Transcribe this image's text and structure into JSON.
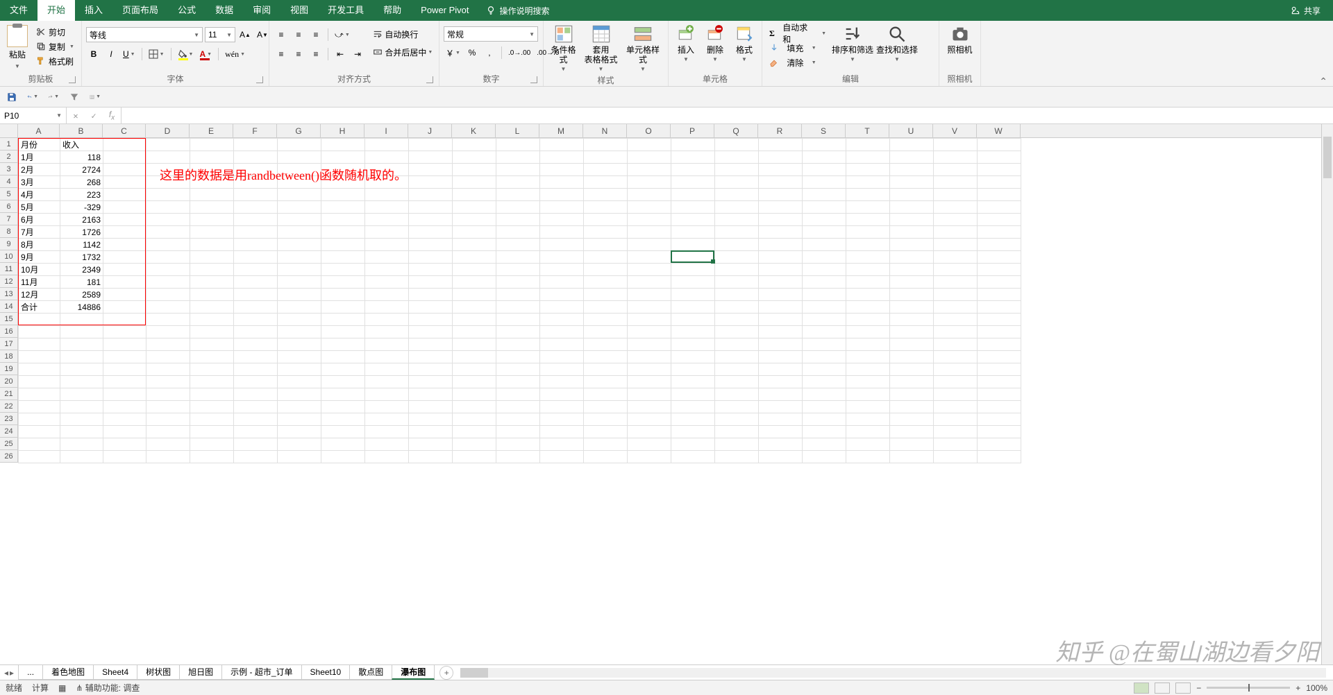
{
  "tabs": {
    "file": "文件",
    "home": "开始",
    "insert": "插入",
    "layout": "页面布局",
    "formulas": "公式",
    "data": "数据",
    "review": "审阅",
    "view": "视图",
    "dev": "开发工具",
    "help": "帮助",
    "powerpivot": "Power Pivot"
  },
  "tellme": "操作说明搜索",
  "share": "共享",
  "ribbon": {
    "clipboard": {
      "paste": "粘贴",
      "cut": "剪切",
      "copy": "复制",
      "painter": "格式刷",
      "label": "剪贴板"
    },
    "font": {
      "name": "等线",
      "size": "11",
      "label": "字体",
      "bold": "B",
      "italic": "I",
      "underline": "U"
    },
    "align": {
      "wrap": "自动换行",
      "merge": "合并后居中",
      "label": "对齐方式"
    },
    "number": {
      "format": "常规",
      "label": "数字",
      "percent": "%",
      "comma": ","
    },
    "styles": {
      "cond": "条件格式",
      "table": "套用\n表格格式",
      "cell": "单元格样式",
      "label": "样式"
    },
    "cells": {
      "insert": "插入",
      "delete": "删除",
      "format": "格式",
      "label": "单元格"
    },
    "editing": {
      "sum": "自动求和",
      "fill": "填充",
      "clear": "清除",
      "sort": "排序和筛选",
      "find": "查找和选择",
      "label": "编辑"
    },
    "camera": {
      "label": "照相机",
      "btn": "照相机"
    }
  },
  "namebox": "P10",
  "columns": [
    "A",
    "B",
    "C",
    "D",
    "E",
    "F",
    "G",
    "H",
    "I",
    "J",
    "K",
    "L",
    "M",
    "N",
    "O",
    "P",
    "Q",
    "R",
    "S",
    "T",
    "U",
    "V",
    "W"
  ],
  "row_count_visible": 26,
  "table": {
    "header": [
      "月份",
      "收入"
    ],
    "rows": [
      [
        "1月",
        118
      ],
      [
        "2月",
        2724
      ],
      [
        "3月",
        268
      ],
      [
        "4月",
        223
      ],
      [
        "5月",
        -329
      ],
      [
        "6月",
        2163
      ],
      [
        "7月",
        1726
      ],
      [
        "8月",
        1142
      ],
      [
        "9月",
        1732
      ],
      [
        "10月",
        2349
      ],
      [
        "11月",
        181
      ],
      [
        "12月",
        2589
      ],
      [
        "合计",
        14886
      ]
    ]
  },
  "annotation": "这里的数据是用randbetween()函数随机取的。",
  "active_cell": {
    "col": "P",
    "row": 10
  },
  "sheets": {
    "list": [
      "着色地图",
      "Sheet4",
      "树状图",
      "旭日图",
      "示例 - 超市_订单",
      "Sheet10",
      "散点图",
      "瀑布图"
    ],
    "more": "...",
    "active": "瀑布图"
  },
  "status": {
    "ready": "就绪",
    "calc": "计算",
    "access": "辅助功能: 调查",
    "zoom": "100%"
  },
  "watermark": "知乎 @在蜀山湖边看夕阳"
}
